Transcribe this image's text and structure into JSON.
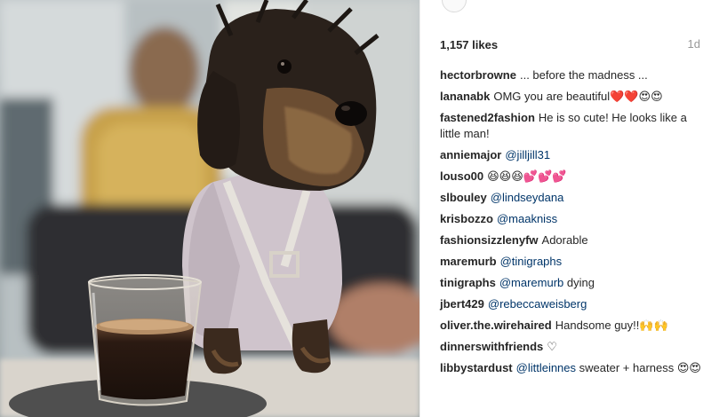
{
  "post": {
    "likes_text": "1,157 likes",
    "age_text": "1d"
  },
  "comments": [
    {
      "user": "hectorbrowne",
      "text": "... before the madness ..."
    },
    {
      "user": "lananabk",
      "text": "OMG you are beautiful",
      "emoji": "❤️❤️😍😍"
    },
    {
      "user": "fastened2fashion",
      "text": "He is so cute! He looks like a little man!"
    },
    {
      "user": "anniemajor",
      "mention": "@jilljill31"
    },
    {
      "user": "louso00",
      "emoji": "😆😆😆💕💕💕"
    },
    {
      "user": "slbouley",
      "mention": "@lindseydana"
    },
    {
      "user": "krisbozzo",
      "mention": "@maakniss"
    },
    {
      "user": "fashionsizzlenyfw",
      "text": "Adorable"
    },
    {
      "user": "maremurb",
      "mention": "@tinigraphs"
    },
    {
      "user": "tinigraphs",
      "mention": "@maremurb",
      "text": "dying"
    },
    {
      "user": "jbert429",
      "mention": "@rebeccaweisberg"
    },
    {
      "user": "oliver.the.wirehaired",
      "text": "Handsome guy!!",
      "emoji": "🙌🙌"
    },
    {
      "user": "dinnerswithfriends",
      "emoji": "♡"
    },
    {
      "user": "libbystardust",
      "mention": "@littleinnes",
      "text": "sweater + harness",
      "emoji": "😍😍"
    }
  ],
  "photo": {
    "icon": "dog-photo"
  },
  "colors": {
    "text": "#262626",
    "muted": "#999999",
    "mention": "#003569"
  }
}
